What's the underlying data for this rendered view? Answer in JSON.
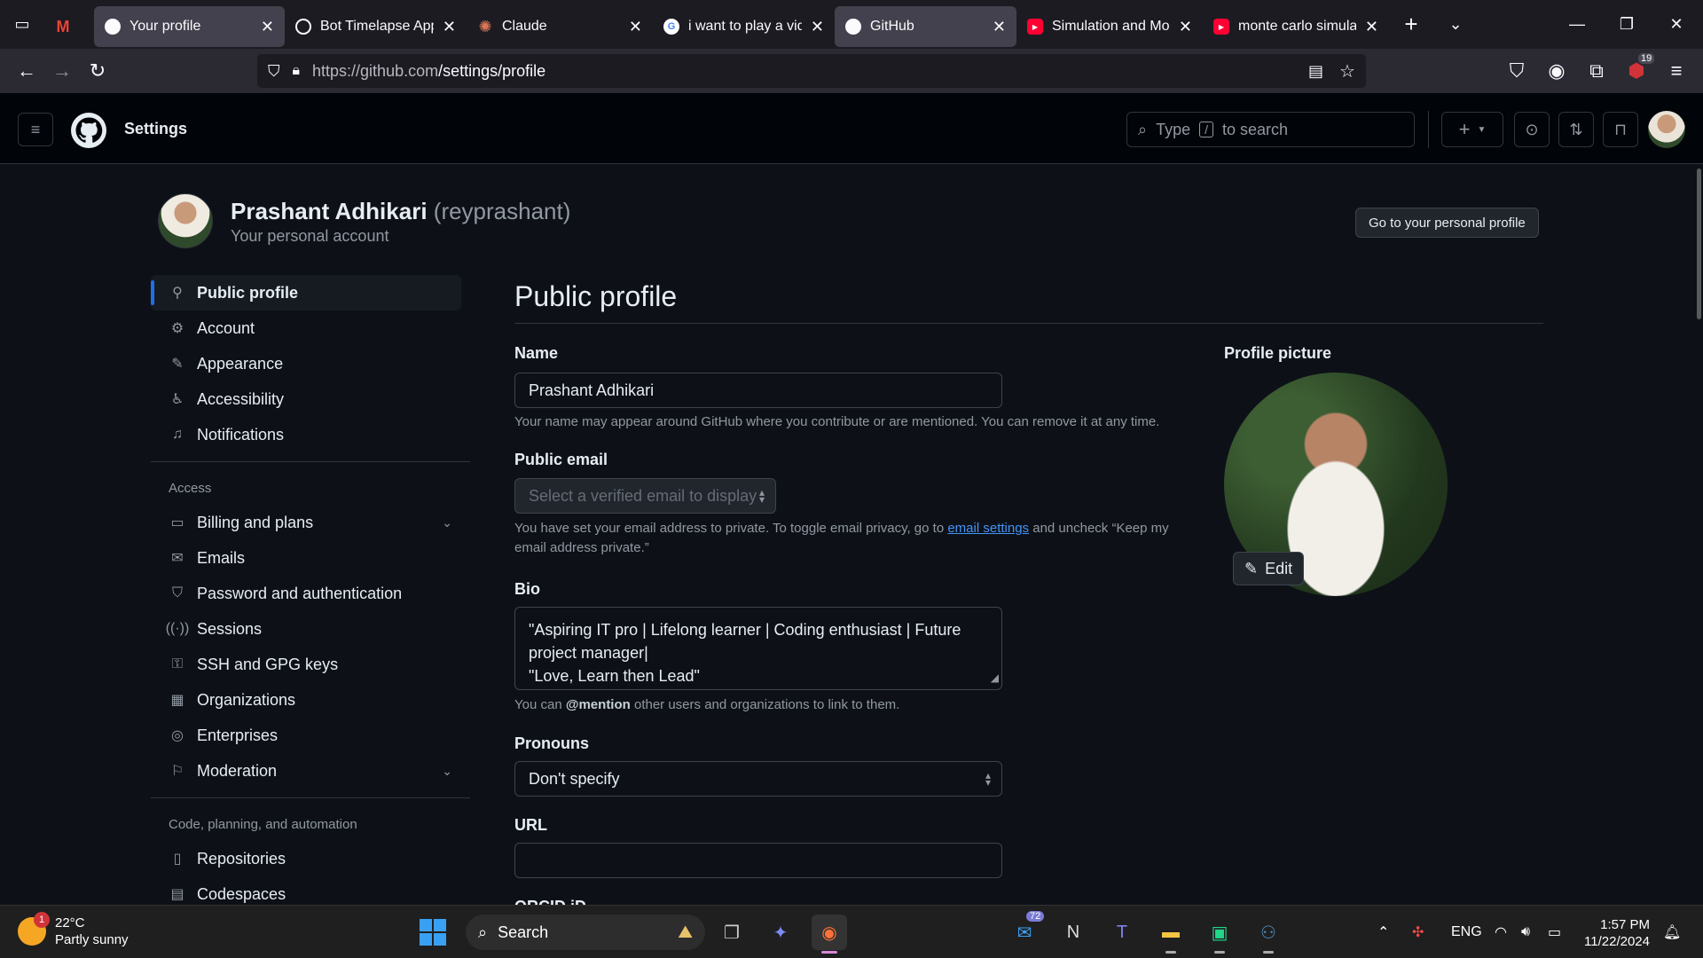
{
  "browser": {
    "tabs": [
      {
        "label": "",
        "icon": "gmail-icon",
        "color": "#ea4335"
      },
      {
        "label": "Your profile",
        "icon": "github-icon",
        "active": true
      },
      {
        "label": "Bot Timelapse App (",
        "icon": "openai-icon"
      },
      {
        "label": "Claude",
        "icon": "claude-icon",
        "color": "#d97757"
      },
      {
        "label": "i want to play a vide",
        "icon": "google-icon"
      },
      {
        "label": "GitHub",
        "icon": "github-icon"
      },
      {
        "label": "Simulation and Mod",
        "icon": "youtube-icon",
        "color": "#ff0033"
      },
      {
        "label": "monte carlo simulati",
        "icon": "youtube-icon",
        "color": "#ff0033"
      }
    ],
    "url": "https://github.com/settings/profile",
    "url_host": "https://github.com",
    "url_path": "/settings/profile",
    "extension_badge": "19"
  },
  "header": {
    "title": "Settings",
    "search_prefix": "Type",
    "search_key": "/",
    "search_suffix": "to search"
  },
  "account": {
    "name": "Prashant Adhikari",
    "login": "(reyprashant)",
    "subtitle": "Your personal account",
    "go_button": "Go to your personal profile"
  },
  "sidebar": {
    "items": [
      {
        "label": "Public profile",
        "icon": "person-icon",
        "active": true
      },
      {
        "label": "Account",
        "icon": "gear-icon"
      },
      {
        "label": "Appearance",
        "icon": "paintbrush-icon"
      },
      {
        "label": "Accessibility",
        "icon": "accessibility-icon"
      },
      {
        "label": "Notifications",
        "icon": "bell-icon"
      }
    ],
    "access_heading": "Access",
    "access_items": [
      {
        "label": "Billing and plans",
        "icon": "credit-card-icon",
        "expandable": true
      },
      {
        "label": "Emails",
        "icon": "mail-icon"
      },
      {
        "label": "Password and authentication",
        "icon": "shield-lock-icon"
      },
      {
        "label": "Sessions",
        "icon": "broadcast-icon"
      },
      {
        "label": "SSH and GPG keys",
        "icon": "key-icon"
      },
      {
        "label": "Organizations",
        "icon": "organization-icon"
      },
      {
        "label": "Enterprises",
        "icon": "globe-icon"
      },
      {
        "label": "Moderation",
        "icon": "report-icon",
        "expandable": true
      }
    ],
    "code_heading": "Code, planning, and automation",
    "code_items": [
      {
        "label": "Repositories",
        "icon": "repo-icon"
      },
      {
        "label": "Codespaces",
        "icon": "codespaces-icon"
      }
    ]
  },
  "main": {
    "title": "Public profile",
    "name_label": "Name",
    "name_value": "Prashant Adhikari",
    "name_note": "Your name may appear around GitHub where you contribute or are mentioned. You can remove it at any time.",
    "email_label": "Public email",
    "email_placeholder": "Select a verified email to display",
    "email_note_pre": "You have set your email address to private. To toggle email privacy, go to",
    "email_note_link": "email settings",
    "email_note_post": "and uncheck “Keep my",
    "email_note_line2": "email address private.”",
    "bio_label": "Bio",
    "bio_line1": "\"Aspiring IT pro | Lifelong learner  | Coding enthusiast | Future",
    "bio_line2": "project manager|",
    "bio_line3": "\"Love, Learn then Lead\"",
    "bio_note_pre": "You can",
    "bio_note_mention": "@mention",
    "bio_note_post": "other users and organizations to link to them.",
    "pronouns_label": "Pronouns",
    "pronouns_value": "Don't specify",
    "url_label": "URL",
    "url_value": "",
    "orcid_label": "ORCID iD",
    "picture_label": "Profile picture",
    "edit_label": "Edit"
  },
  "taskbar": {
    "weather_temp": "22°C",
    "weather_desc": "Partly sunny",
    "weather_badge": "1",
    "search_label": "Search",
    "mail_badge": "72",
    "lang": "ENG",
    "time": "1:57 PM",
    "date": "11/22/2024"
  },
  "colors": {
    "accent": "#1f6feb",
    "link": "#4493f8",
    "page_bg": "#0d1117"
  }
}
